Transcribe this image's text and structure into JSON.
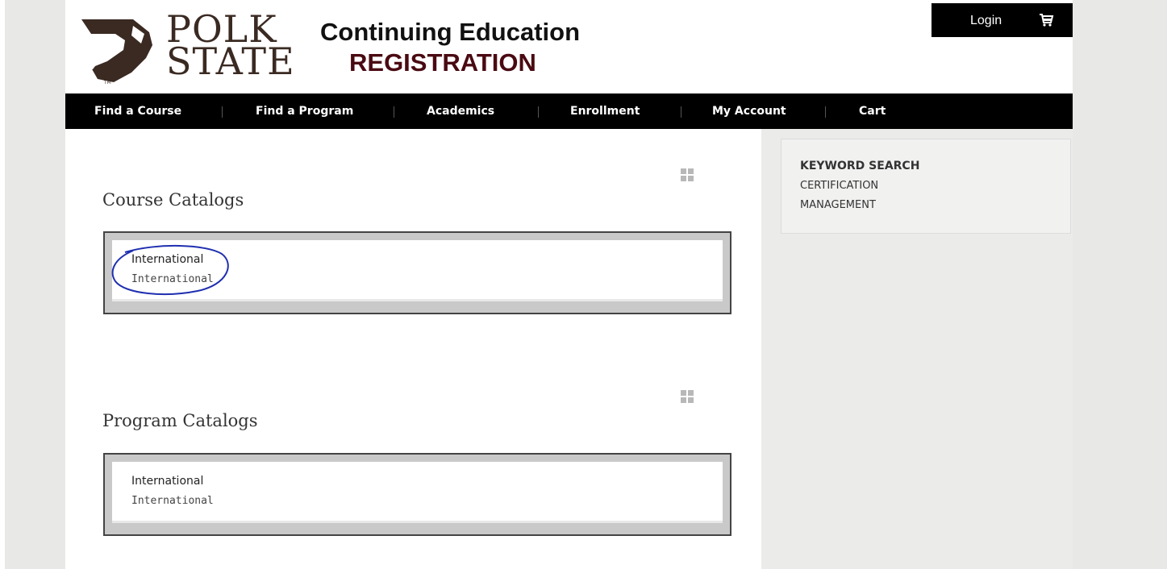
{
  "header": {
    "logo_line1": "POLK",
    "logo_line2": "STATE",
    "logo_mark": "TM",
    "title_top": "Continuing Education",
    "title_bottom": "REGISTRATION",
    "login_label": "Login",
    "cart_icon": "shopping-cart-icon"
  },
  "nav": {
    "items": [
      {
        "label": "Find a Course"
      },
      {
        "label": "Find a Program"
      },
      {
        "label": "Academics"
      },
      {
        "label": "Enrollment"
      },
      {
        "label": "My Account"
      },
      {
        "label": "Cart"
      }
    ]
  },
  "main": {
    "course_section": {
      "title": "Course Catalogs",
      "item_name": "International",
      "item_sub": "International"
    },
    "program_section": {
      "title": "Program Catalogs",
      "item_name": "International",
      "item_sub": "International"
    },
    "grid_icon": "grid-view-icon"
  },
  "sidebar": {
    "heading": "KEYWORD SEARCH",
    "items": [
      {
        "label": "CERTIFICATION"
      },
      {
        "label": "MANAGEMENT"
      }
    ]
  },
  "colors": {
    "nav_bg": "#000000",
    "title_dark_red": "#4a0a12",
    "logo_brown": "#3a2a22",
    "annotation_blue": "#1f2fb0"
  }
}
